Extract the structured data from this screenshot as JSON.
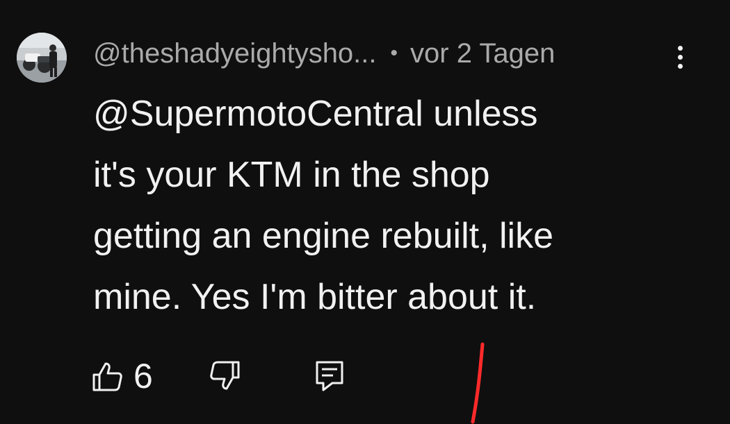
{
  "comment": {
    "author": "@theshadyeightysho...",
    "separator": "•",
    "timestamp": "vor 2 Tagen",
    "text": "@SupermotoCentral  unless\nit's your KTM in the shop\ngetting an engine rebuilt, like\nmine.  Yes I'm bitter about it.",
    "like_count": "6"
  },
  "icons": {
    "avatar": "avatar-photo",
    "menu": "more-vertical-icon",
    "like": "thumb-up-icon",
    "dislike": "thumb-down-icon",
    "reply": "comment-reply-icon"
  },
  "colors": {
    "background": "#0f0f0f",
    "primary_text": "#f1f1f1",
    "secondary_text": "#aaaaaa",
    "annotation": "#ff2a2a"
  }
}
